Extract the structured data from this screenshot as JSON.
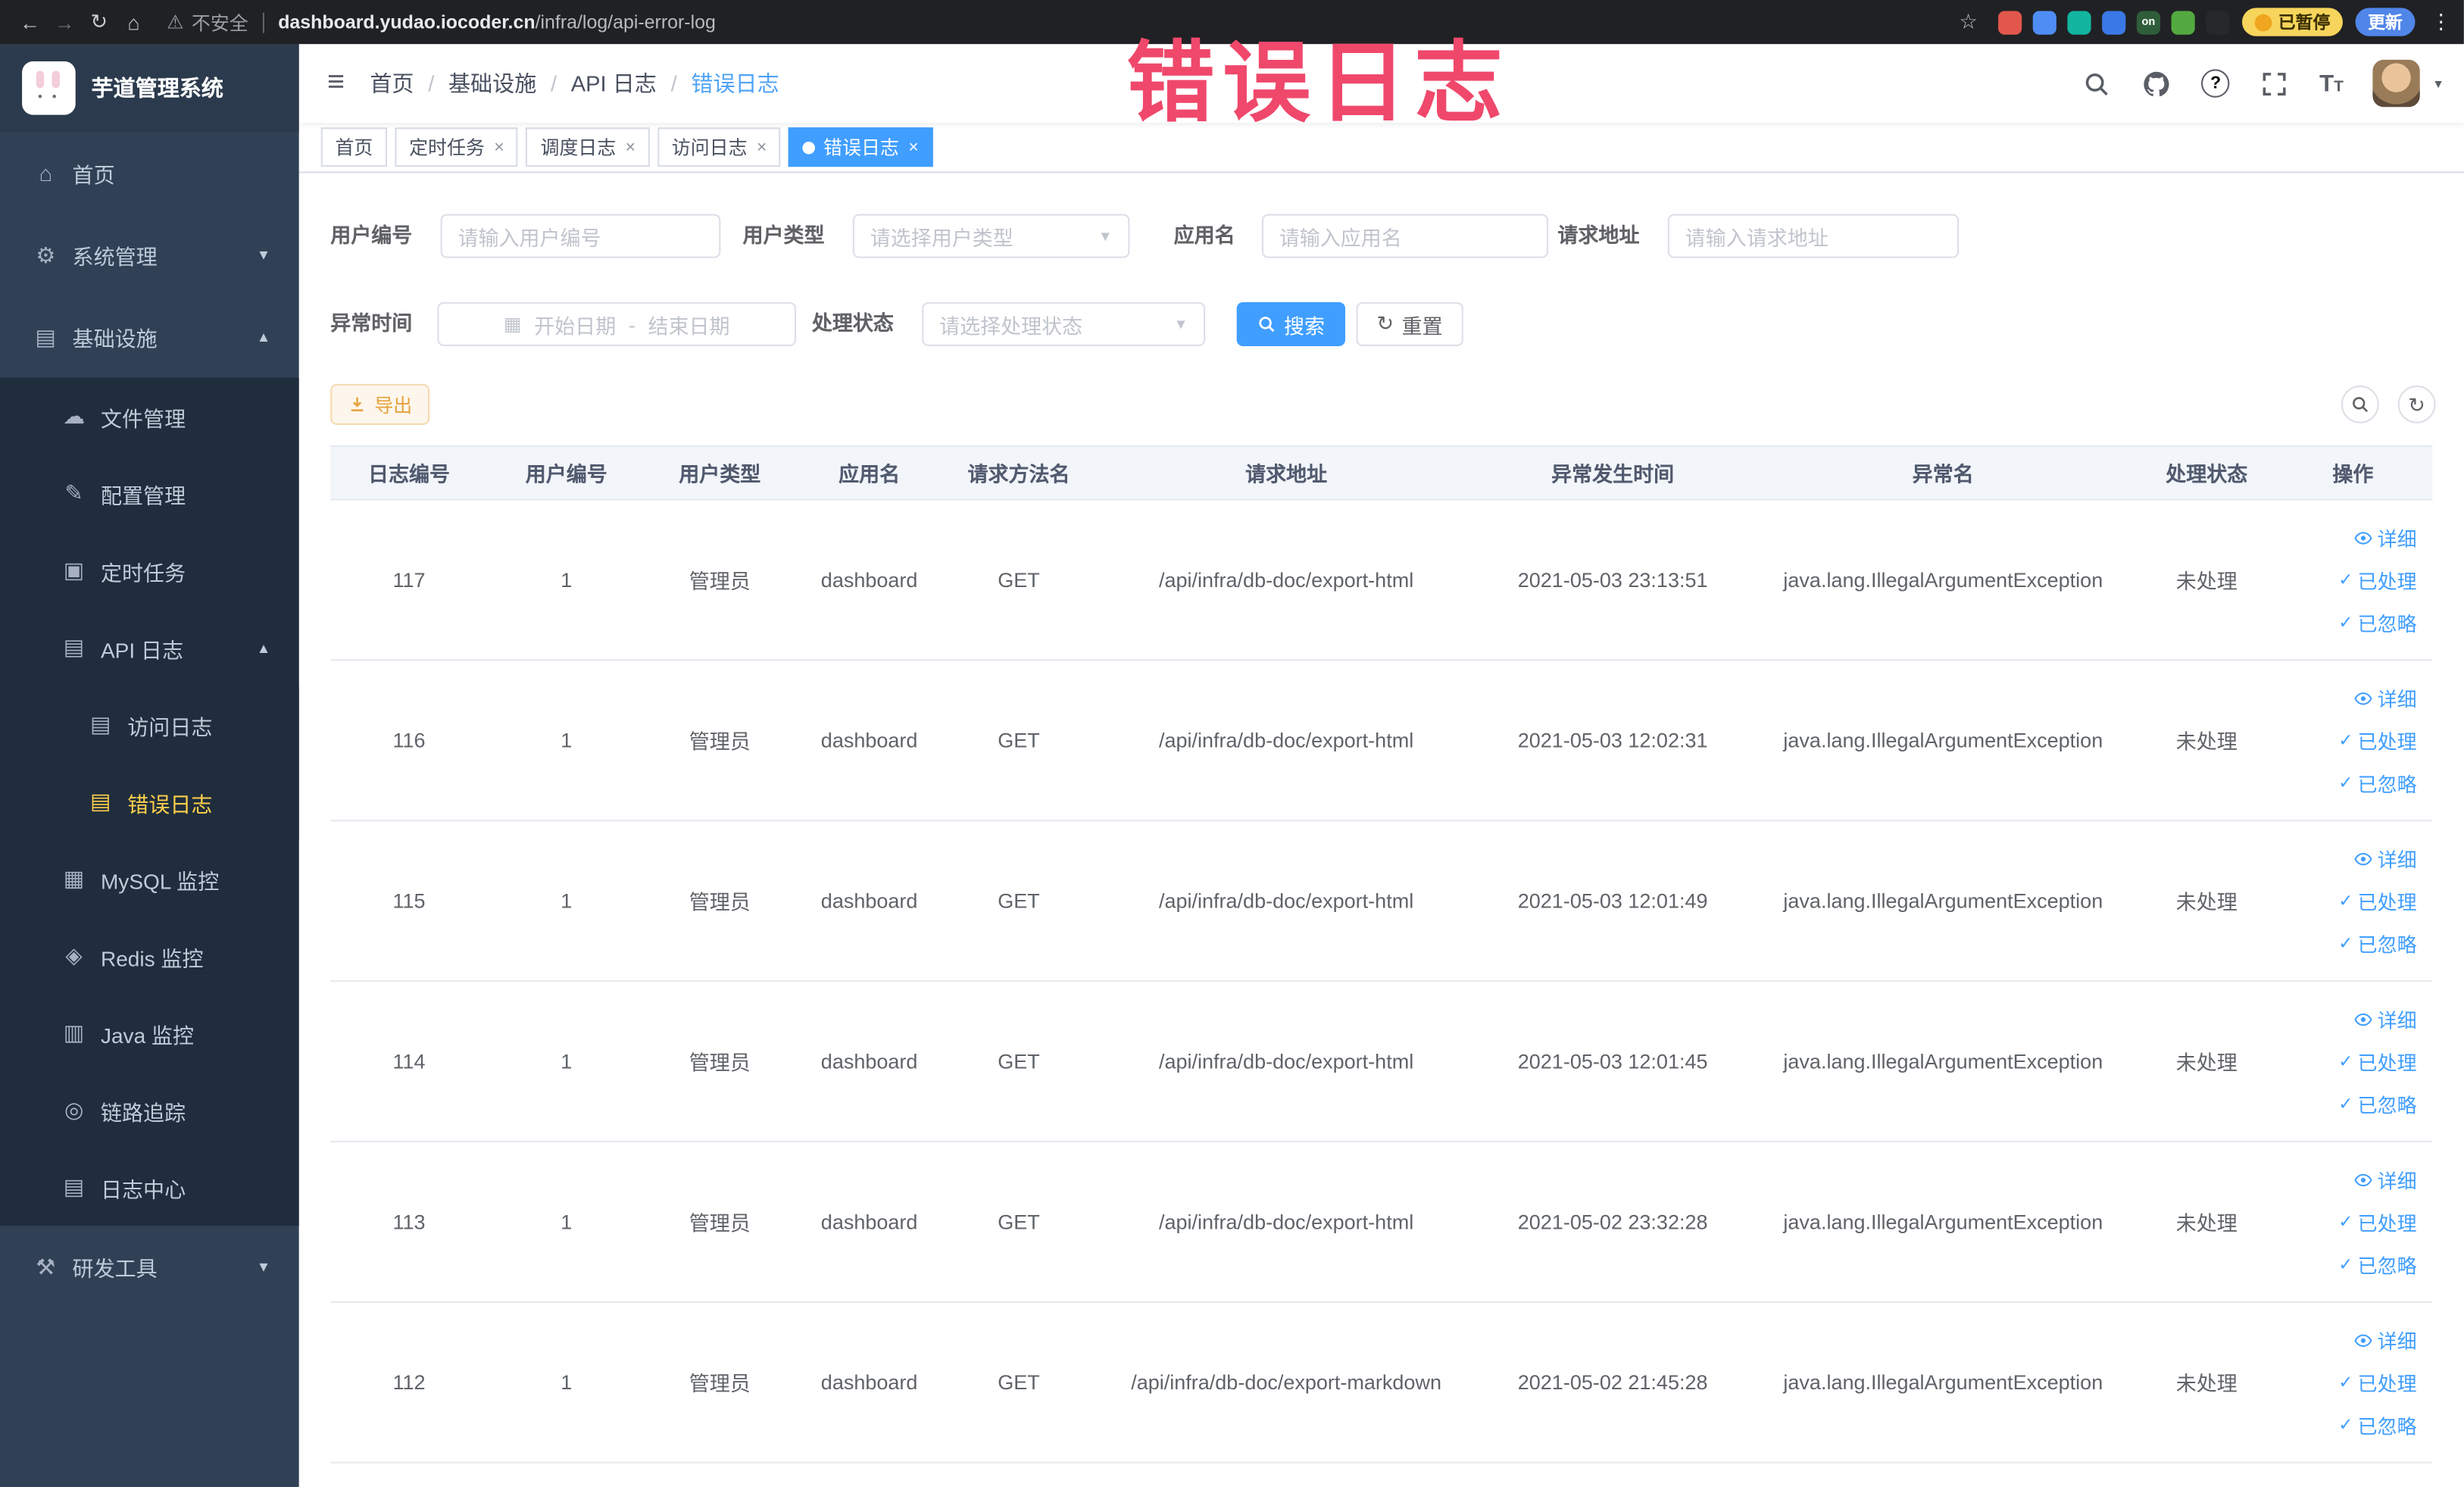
{
  "browser": {
    "security_label": "不安全",
    "url_domain": "dashboard.yudao.iocoder.cn",
    "url_path": "/infra/log/api-error-log",
    "paused_badge": "已暂停",
    "update_button": "更新",
    "extensions": [
      {
        "name": "extension-red",
        "color": "#e2574c"
      },
      {
        "name": "extension-blue-drop",
        "color": "#4f8df5"
      },
      {
        "name": "extension-teal",
        "color": "#12b5a0"
      },
      {
        "name": "extension-blue-grid",
        "color": "#3b78e7"
      },
      {
        "name": "extension-on-switch",
        "color": "#2f5d3a",
        "text": "on"
      },
      {
        "name": "extension-green",
        "color": "#53a93f"
      },
      {
        "name": "extension-dark",
        "color": "#26282b"
      }
    ]
  },
  "watermark_text": "错误日志",
  "sidebar": {
    "logo_title": "芋道管理系统",
    "menu": [
      {
        "label": "首页",
        "icon": "home-icon"
      },
      {
        "label": "系统管理",
        "icon": "gear-icon",
        "expandable": true,
        "expanded": false
      },
      {
        "label": "基础设施",
        "icon": "monitor-icon",
        "expandable": true,
        "expanded": true,
        "children": [
          {
            "label": "文件管理",
            "icon": "cloud-icon"
          },
          {
            "label": "配置管理",
            "icon": "edit-icon"
          },
          {
            "label": "定时任务",
            "icon": "task-icon"
          },
          {
            "label": "API 日志",
            "icon": "doc-icon",
            "expandable": true,
            "expanded": true,
            "children": [
              {
                "label": "访问日志",
                "icon": "doc-icon"
              },
              {
                "label": "错误日志",
                "icon": "doc-icon",
                "active": true
              }
            ]
          },
          {
            "label": "MySQL 监控",
            "icon": "grid-icon"
          },
          {
            "label": "Redis 监控",
            "icon": "layers-icon"
          },
          {
            "label": "Java 监控",
            "icon": "coffee-icon"
          },
          {
            "label": "链路追踪",
            "icon": "eye-icon"
          },
          {
            "label": "日志中心",
            "icon": "doc-icon"
          }
        ]
      },
      {
        "label": "研发工具",
        "icon": "tools-icon",
        "expandable": true,
        "expanded": false
      }
    ]
  },
  "navbar": {
    "breadcrumb": [
      "首页",
      "基础设施",
      "API 日志",
      "错误日志"
    ]
  },
  "tags": [
    {
      "label": "首页",
      "closable": false,
      "active": false
    },
    {
      "label": "定时任务",
      "closable": true,
      "active": false
    },
    {
      "label": "调度日志",
      "closable": true,
      "active": false
    },
    {
      "label": "访问日志",
      "closable": true,
      "active": false
    },
    {
      "label": "错误日志",
      "closable": true,
      "active": true
    }
  ],
  "filters": {
    "user_id": {
      "label": "用户编号",
      "placeholder": "请输入用户编号"
    },
    "user_type": {
      "label": "用户类型",
      "placeholder": "请选择用户类型"
    },
    "app_name": {
      "label": "应用名",
      "placeholder": "请输入应用名"
    },
    "request_url": {
      "label": "请求地址",
      "placeholder": "请输入请求地址"
    },
    "exception_time": {
      "label": "异常时间",
      "start_placeholder": "开始日期",
      "separator": "-",
      "end_placeholder": "结束日期"
    },
    "process_status": {
      "label": "处理状态",
      "placeholder": "请选择处理状态"
    },
    "search_button": "搜索",
    "reset_button": "重置"
  },
  "toolbar": {
    "export_button": "导出"
  },
  "table": {
    "columns": [
      "日志编号",
      "用户编号",
      "用户类型",
      "应用名",
      "请求方法名",
      "请求地址",
      "异常发生时间",
      "异常名",
      "处理状态",
      "操作"
    ],
    "actions": [
      {
        "label": "详细",
        "icon": "eye-icon"
      },
      {
        "label": "已处理",
        "icon": "check-icon"
      },
      {
        "label": "已忽略",
        "icon": "check-icon"
      }
    ],
    "rows": [
      {
        "id": "117",
        "user_id": "1",
        "user_type": "管理员",
        "app": "dashboard",
        "method": "GET",
        "url": "/api/infra/db-doc/export-html",
        "time": "2021-05-03 23:13:51",
        "exception": "java.lang.IllegalArgumentException",
        "status": "未处理"
      },
      {
        "id": "116",
        "user_id": "1",
        "user_type": "管理员",
        "app": "dashboard",
        "method": "GET",
        "url": "/api/infra/db-doc/export-html",
        "time": "2021-05-03 12:02:31",
        "exception": "java.lang.IllegalArgumentException",
        "status": "未处理"
      },
      {
        "id": "115",
        "user_id": "1",
        "user_type": "管理员",
        "app": "dashboard",
        "method": "GET",
        "url": "/api/infra/db-doc/export-html",
        "time": "2021-05-03 12:01:49",
        "exception": "java.lang.IllegalArgumentException",
        "status": "未处理"
      },
      {
        "id": "114",
        "user_id": "1",
        "user_type": "管理员",
        "app": "dashboard",
        "method": "GET",
        "url": "/api/infra/db-doc/export-html",
        "time": "2021-05-03 12:01:45",
        "exception": "java.lang.IllegalArgumentException",
        "status": "未处理"
      },
      {
        "id": "113",
        "user_id": "1",
        "user_type": "管理员",
        "app": "dashboard",
        "method": "GET",
        "url": "/api/infra/db-doc/export-html",
        "time": "2021-05-02 23:32:28",
        "exception": "java.lang.IllegalArgumentException",
        "status": "未处理"
      },
      {
        "id": "112",
        "user_id": "1",
        "user_type": "管理员",
        "app": "dashboard",
        "method": "GET",
        "url": "/api/infra/db-doc/export-markdown",
        "time": "2021-05-02 21:45:28",
        "exception": "java.lang.IllegalArgumentException",
        "status": "未处理"
      }
    ]
  },
  "colors": {
    "accent": "#409EFF",
    "sidebar_bg": "#304156",
    "submenu_bg": "#1f2d3d",
    "active_menu_text": "#ffd04b",
    "warning": "#e6a23c",
    "watermark": "#ef486b",
    "tag_active_bg": "#409EFF"
  }
}
